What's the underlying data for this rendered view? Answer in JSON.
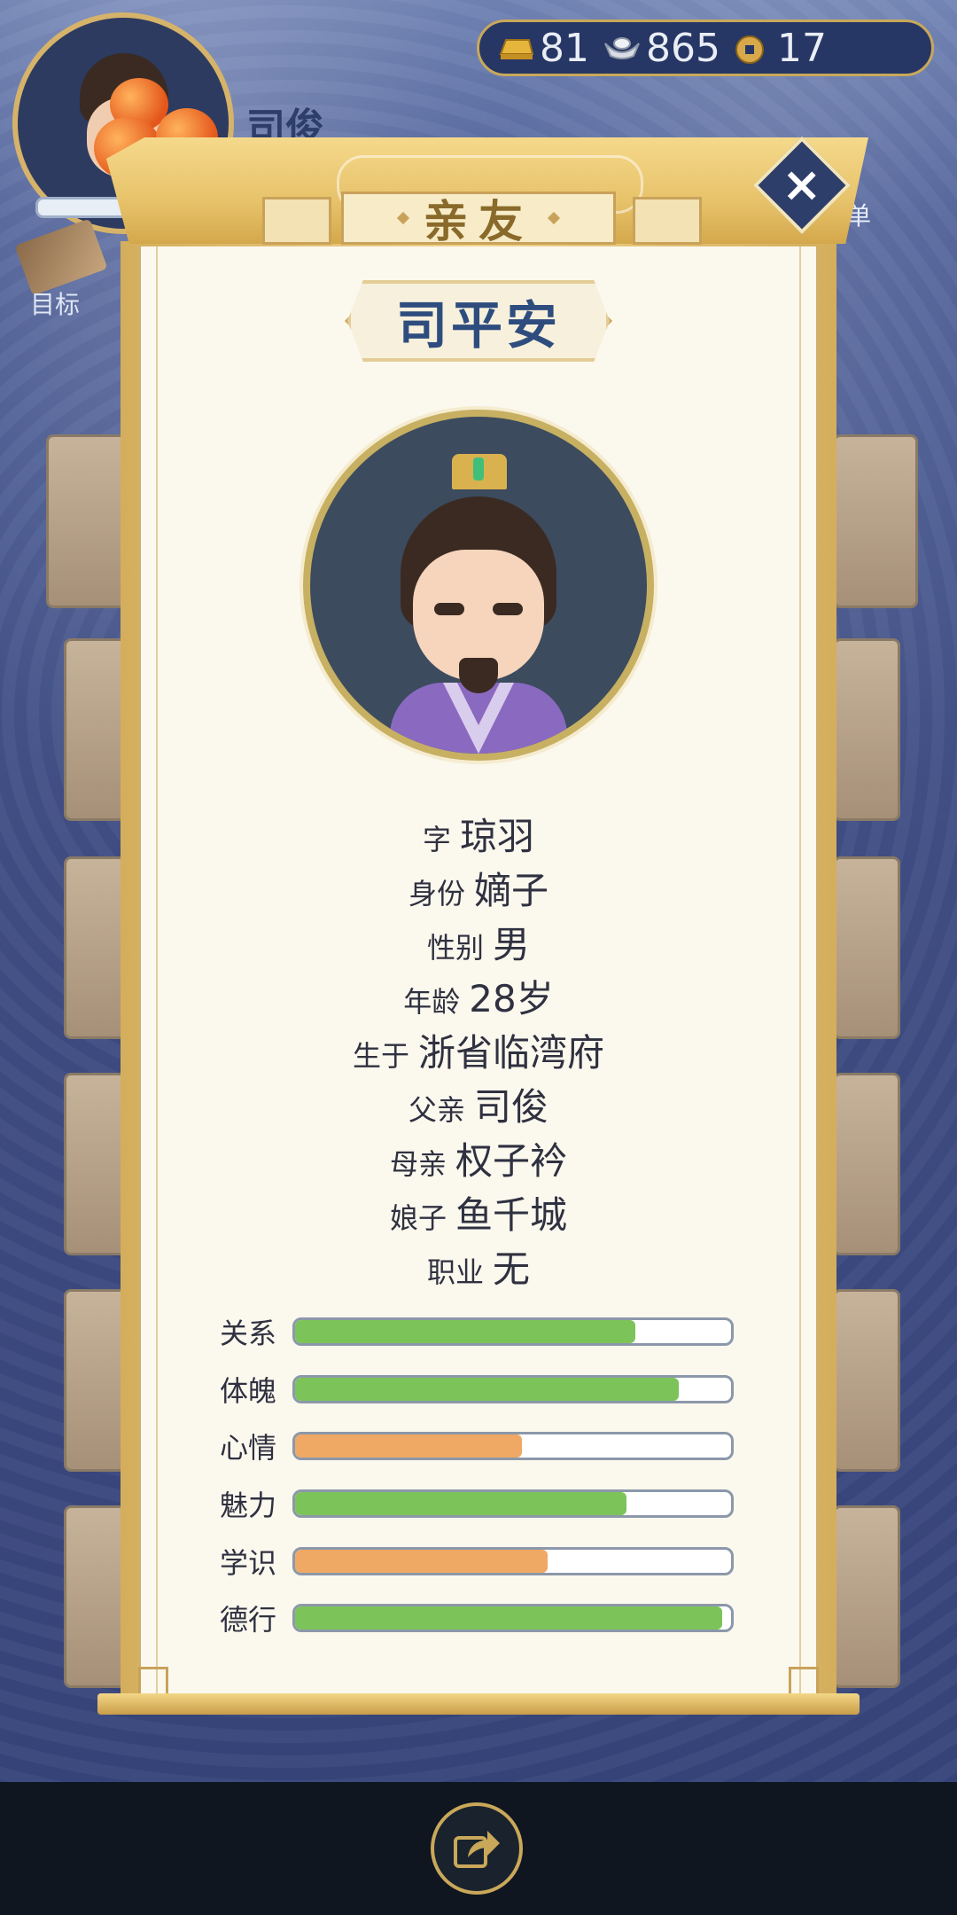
{
  "hud": {
    "player_name": "司俊",
    "goal_label": "目标",
    "menu_label": "单"
  },
  "currency": {
    "gold": "81",
    "silver": "865",
    "coin": "17",
    "icons": [
      "gold-ingot-icon",
      "silver-ingot-icon",
      "copper-coin-icon"
    ]
  },
  "modal": {
    "tab_title": "亲友",
    "close_label": "×",
    "person_name": "司平安",
    "info": [
      {
        "label": "字",
        "value": "琼羽"
      },
      {
        "label": "身份",
        "value": "嫡子"
      },
      {
        "label": "性别",
        "value": "男"
      },
      {
        "label": "年龄",
        "value": "28岁"
      },
      {
        "label": "生于",
        "value": "浙省临湾府"
      },
      {
        "label": "父亲",
        "value": "司俊"
      },
      {
        "label": "母亲",
        "value": "权子衿"
      },
      {
        "label": "娘子",
        "value": "鱼千城"
      },
      {
        "label": "职业",
        "value": "无"
      }
    ],
    "stats": [
      {
        "label": "关系",
        "level": 0.78,
        "color": "#7cc45a"
      },
      {
        "label": "体魄",
        "level": 0.88,
        "color": "#7cc45a"
      },
      {
        "label": "心情",
        "level": 0.52,
        "color": "#f0a865"
      },
      {
        "label": "魅力",
        "level": 0.76,
        "color": "#7cc45a"
      },
      {
        "label": "学识",
        "level": 0.58,
        "color": "#f0a865"
      },
      {
        "label": "德行",
        "level": 0.98,
        "color": "#7cc45a"
      }
    ]
  },
  "bottom": {
    "share_icon": "share-icon"
  }
}
